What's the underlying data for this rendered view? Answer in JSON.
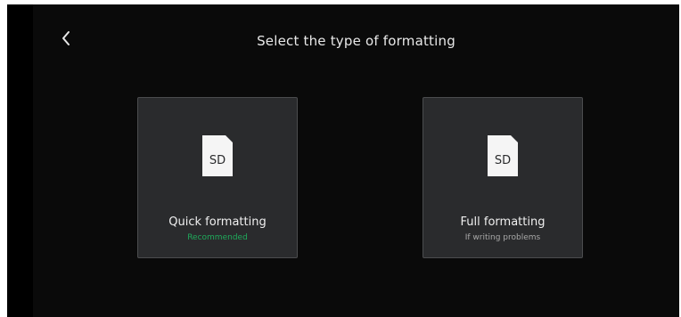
{
  "header": {
    "title": "Select the type of formatting",
    "back_icon": "chevron-left-icon"
  },
  "options": [
    {
      "icon": "sd-card-icon",
      "icon_text": "SD",
      "label": "Quick formatting",
      "sublabel": "Recommended",
      "sublabel_color": "#1faa5b"
    },
    {
      "icon": "sd-card-icon",
      "icon_text": "SD",
      "label": "Full formatting",
      "sublabel": "If writing problems",
      "sublabel_color": "#a8a8a8"
    }
  ],
  "colors": {
    "background": "#0a0a0a",
    "card_background": "#2a2b2d",
    "card_border": "#4b4c4e",
    "text_primary": "#f0f0f0",
    "accent_green": "#1faa5b"
  }
}
